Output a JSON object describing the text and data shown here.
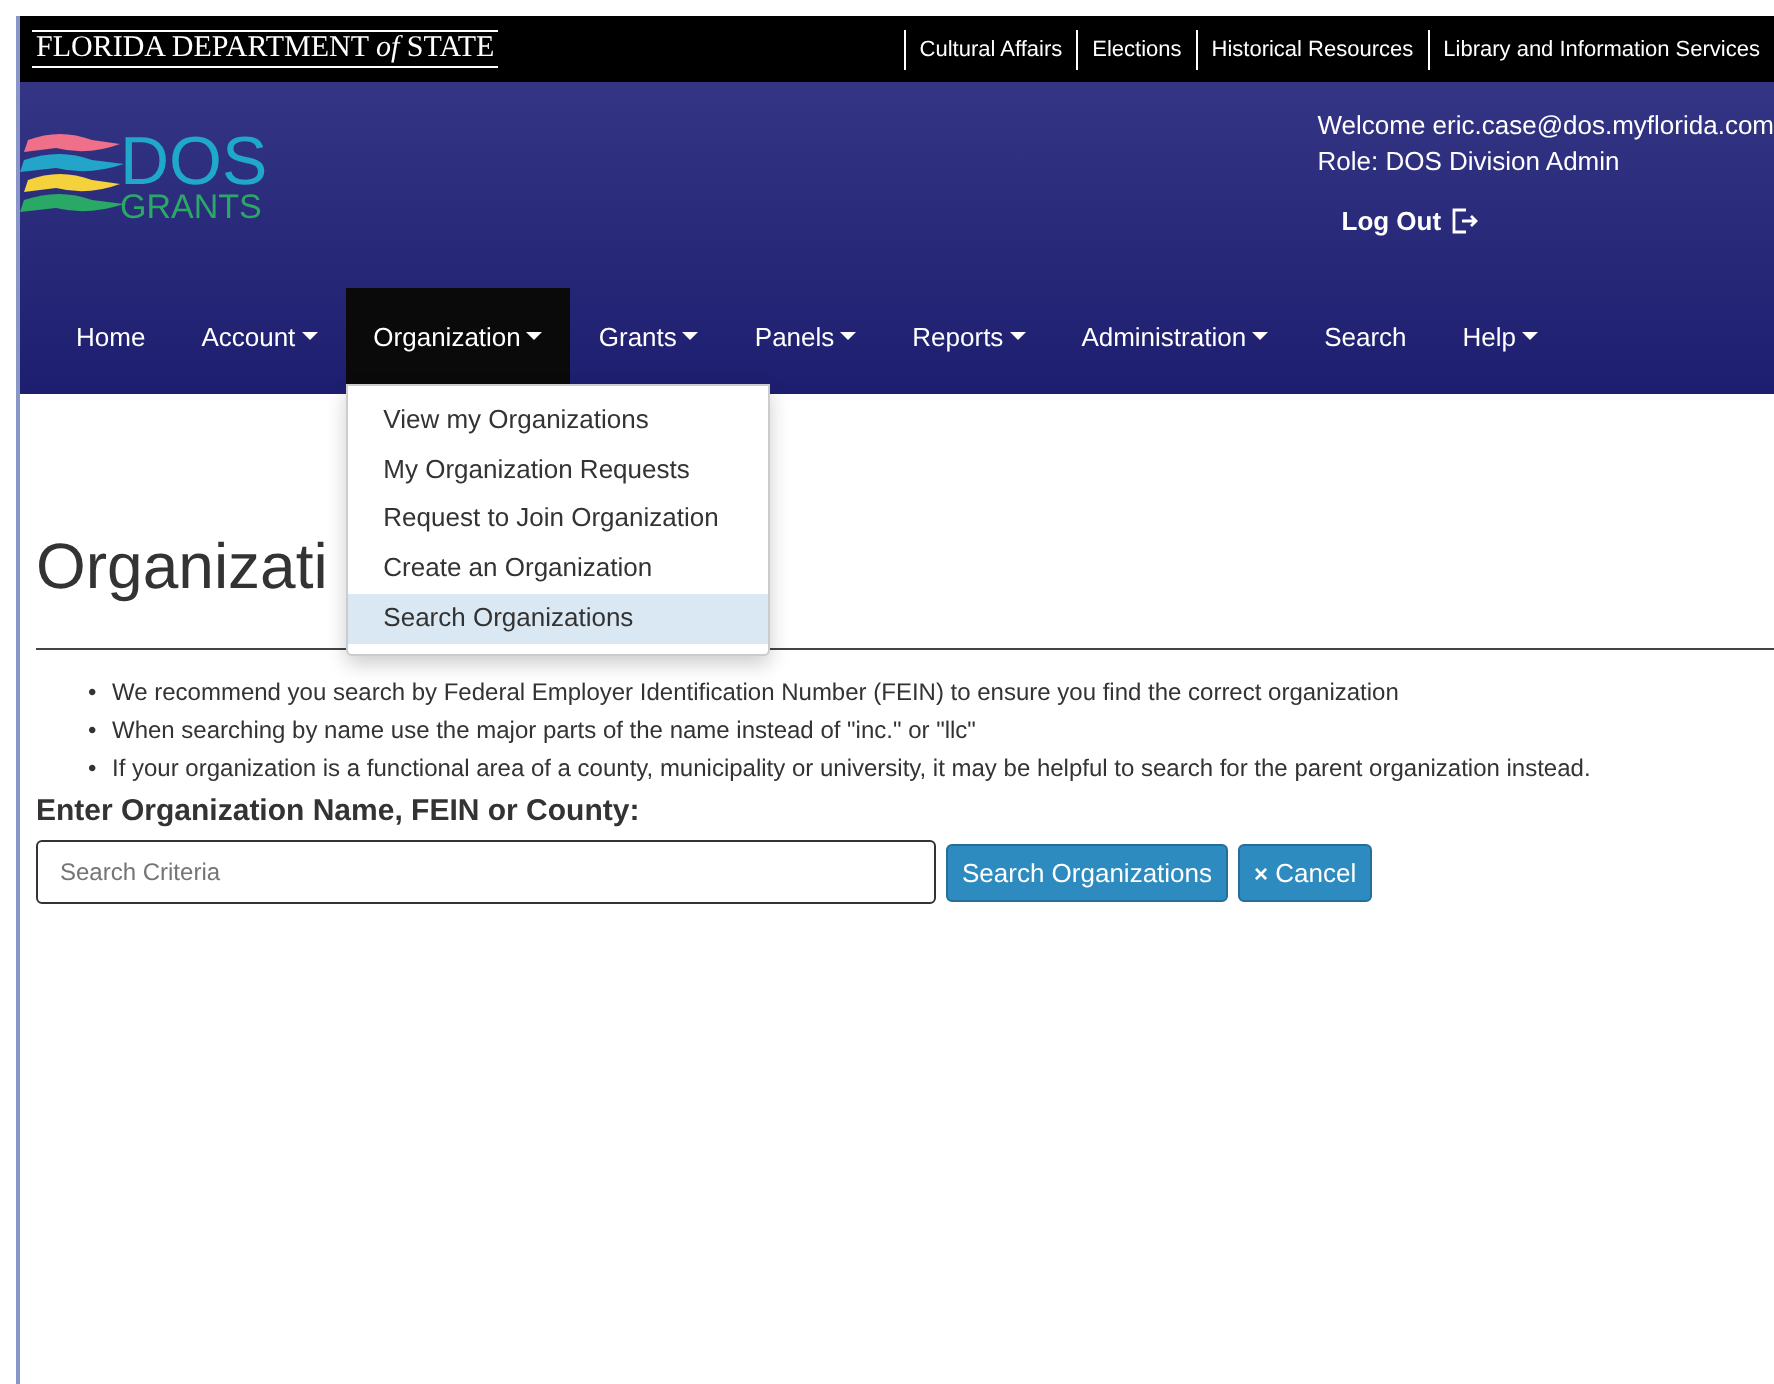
{
  "topbar": {
    "brand": "FLORIDA DEPARTMENT *of* STATE",
    "links": [
      "Cultural Affairs",
      "Elections",
      "Historical Resources",
      "Library and Information Services"
    ]
  },
  "header": {
    "logo_main": "DOS",
    "logo_sub": "GRANTS",
    "welcome": "Welcome eric.case@dos.myflorida.com",
    "role": "Role: DOS Division Admin",
    "logout": "Log Out"
  },
  "nav": [
    {
      "label": "Home",
      "dropdown": false,
      "selected": false
    },
    {
      "label": "Account",
      "dropdown": true,
      "selected": false
    },
    {
      "label": "Organization",
      "dropdown": true,
      "selected": true
    },
    {
      "label": "Grants",
      "dropdown": true,
      "selected": false
    },
    {
      "label": "Panels",
      "dropdown": true,
      "selected": false
    },
    {
      "label": "Reports",
      "dropdown": true,
      "selected": false
    },
    {
      "label": "Administration",
      "dropdown": true,
      "selected": false
    },
    {
      "label": "Search",
      "dropdown": false,
      "selected": false
    },
    {
      "label": "Help",
      "dropdown": true,
      "selected": false
    }
  ],
  "menu": [
    {
      "label": "View my Organizations",
      "selected": false
    },
    {
      "label": "My Organization Requests",
      "selected": false
    },
    {
      "label": "Request to Join Organization",
      "selected": false
    },
    {
      "label": "Create an Organization",
      "selected": false
    },
    {
      "label": "Search Organizations",
      "selected": true
    }
  ],
  "page": {
    "title": "Organizati",
    "bullet": "•",
    "tips": [
      "We recommend you search by Federal Employer Identification Number (FEIN) to ensure you find the correct organization",
      "When searching by name use the major parts of the name instead of \"inc.\" or \"llc\"",
      "If your organization is a functional area of a county, municipality or university, it may be helpful to search for the parent organization instead."
    ],
    "label": "Enter Organization Name, FEIN or County:",
    "search": {
      "placeholder": "Search Criteria"
    },
    "search_button": "Search Organizations",
    "cancel_icon": "×",
    "cancel_button": "Cancel"
  }
}
